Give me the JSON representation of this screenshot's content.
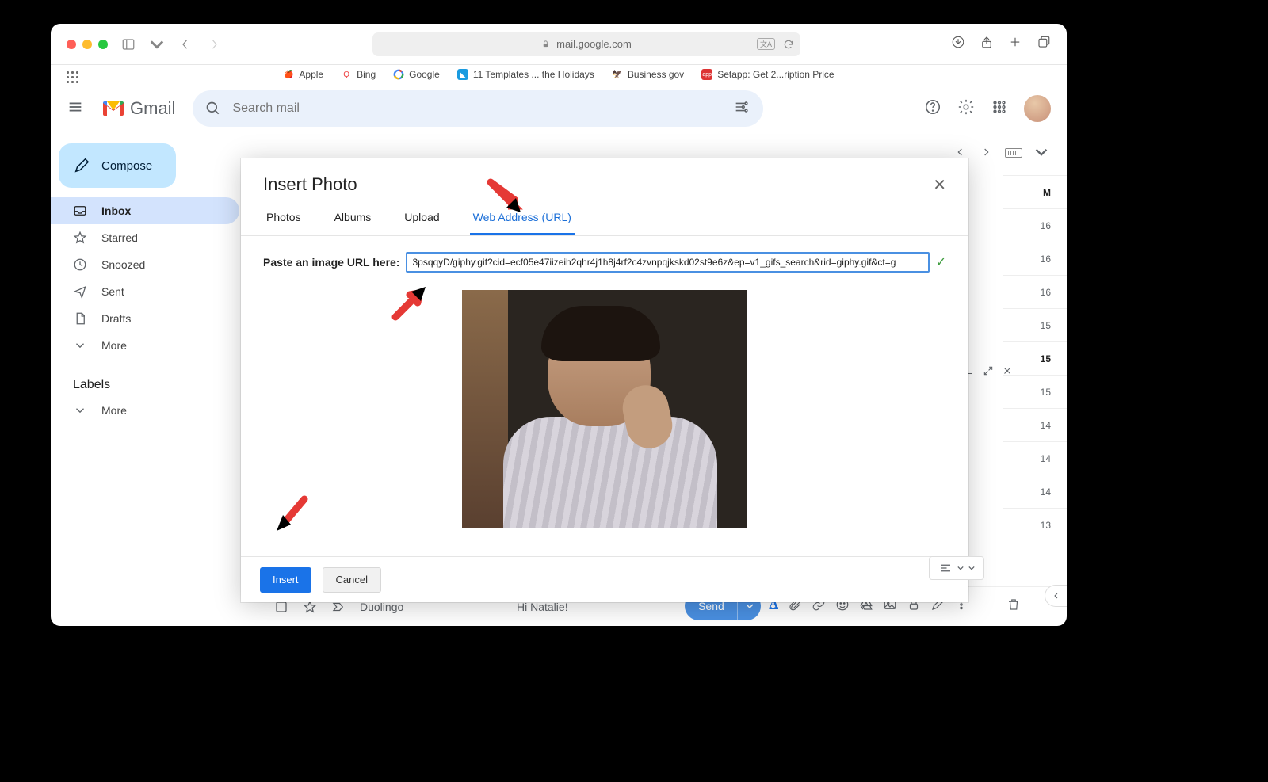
{
  "browser": {
    "url": "mail.google.com",
    "bookmarks": [
      {
        "icon": "apple",
        "label": "Apple"
      },
      {
        "icon": "bing",
        "label": "Bing"
      },
      {
        "icon": "google",
        "label": "Google"
      },
      {
        "icon": "templates",
        "label": "11 Templates ... the Holidays"
      },
      {
        "icon": "gov",
        "label": "Business gov"
      },
      {
        "icon": "setapp",
        "label": "Setapp: Get 2...ription Price"
      }
    ]
  },
  "gmail": {
    "brand": "Gmail",
    "search_placeholder": "Search mail",
    "compose_label": "Compose",
    "nav": [
      {
        "id": "inbox",
        "label": "Inbox",
        "active": true
      },
      {
        "id": "starred",
        "label": "Starred"
      },
      {
        "id": "snoozed",
        "label": "Snoozed"
      },
      {
        "id": "sent",
        "label": "Sent"
      },
      {
        "id": "drafts",
        "label": "Drafts"
      },
      {
        "id": "more",
        "label": "More"
      }
    ],
    "labels_header": "Labels",
    "labels": [
      {
        "id": "more",
        "label": "More"
      }
    ],
    "row_times": [
      "M",
      "16",
      "16",
      "16",
      "15",
      "15",
      "15",
      "14",
      "14",
      "14",
      "13"
    ],
    "list_row": {
      "sender": "Duolingo",
      "subject": "Hi Natalie!"
    },
    "send_label": "Send"
  },
  "modal": {
    "title": "Insert Photo",
    "tabs": [
      "Photos",
      "Albums",
      "Upload",
      "Web Address (URL)"
    ],
    "active_tab": "Web Address (URL)",
    "url_label": "Paste an image URL here:",
    "url_value": "3psqqyD/giphy.gif?cid=ecf05e47iizeih2qhr4j1h8j4rf2c4zvnpqjkskd02st9e6z&ep=v1_gifs_search&rid=giphy.gif&ct=g",
    "insert_label": "Insert",
    "cancel_label": "Cancel"
  }
}
